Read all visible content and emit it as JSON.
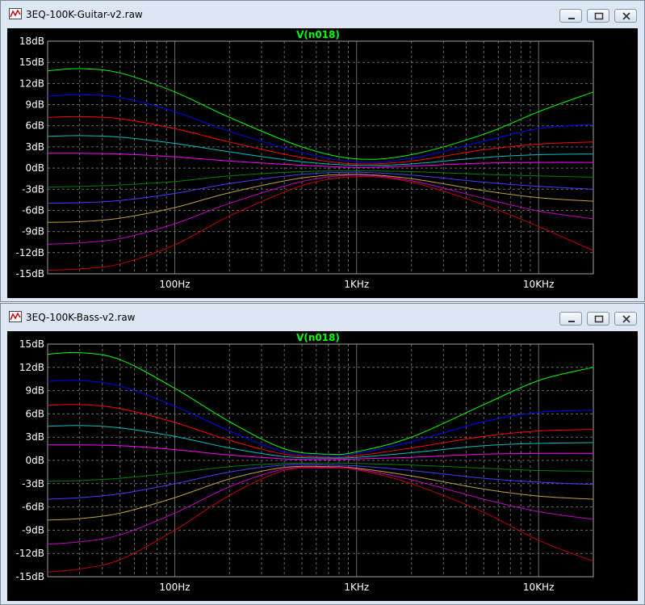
{
  "windows": [
    {
      "title": "3EQ-100K-Guitar-v2.raw",
      "chart_data": {
        "type": "line",
        "title": "V(n018)",
        "x_scale": "log",
        "xlim": [
          20,
          20000
        ],
        "ylim": [
          -15,
          18
        ],
        "y_ticks": [
          "18dB",
          "15dB",
          "12dB",
          "9dB",
          "6dB",
          "3dB",
          "0dB",
          "-3dB",
          "-6dB",
          "-9dB",
          "-12dB",
          "-15dB"
        ],
        "y_tick_values": [
          18,
          15,
          12,
          9,
          6,
          3,
          0,
          -3,
          -6,
          -9,
          -12,
          -15
        ],
        "x_ticks": [
          "100Hz",
          "1KHz",
          "10KHz"
        ],
        "x_tick_values": [
          100,
          1000,
          10000
        ],
        "x": [
          20,
          30,
          50,
          100,
          200,
          500,
          1000,
          2000,
          5000,
          10000,
          20000
        ],
        "series": [
          {
            "color": "#00ff00",
            "values": [
              13.8,
              14.1,
              13.5,
              10.8,
              7.2,
              3.0,
              1.3,
              1.9,
              4.8,
              8.0,
              10.8
            ]
          },
          {
            "color": "#0000ff",
            "values": [
              10.2,
              10.4,
              10.0,
              8.0,
              5.2,
              2.2,
              0.9,
              1.4,
              3.8,
              5.6,
              6.2
            ]
          },
          {
            "color": "#ff0000",
            "values": [
              7.2,
              7.3,
              7.0,
              5.6,
              3.7,
              1.5,
              0.6,
              1.0,
              2.6,
              3.4,
              3.7
            ]
          },
          {
            "color": "#00c0c0",
            "values": [
              4.5,
              4.6,
              4.4,
              3.5,
              2.3,
              0.9,
              0.4,
              0.6,
              1.5,
              1.9,
              2.0
            ]
          },
          {
            "color": "#ff00ff",
            "values": [
              2.1,
              2.1,
              2.0,
              1.6,
              1.0,
              0.4,
              0.1,
              0.3,
              0.7,
              0.8,
              0.8
            ]
          },
          {
            "color": "#008000",
            "values": [
              -2.7,
              -2.6,
              -2.4,
              -1.9,
              -1.1,
              -0.5,
              -0.4,
              -0.5,
              -0.9,
              -1.1,
              -1.3
            ]
          },
          {
            "color": "#4040ff",
            "values": [
              -5.0,
              -4.9,
              -4.6,
              -3.6,
              -2.2,
              -0.9,
              -0.6,
              -1.0,
              -2.0,
              -2.6,
              -3.0
            ]
          },
          {
            "color": "#c0a040",
            "values": [
              -7.7,
              -7.6,
              -7.1,
              -5.6,
              -3.5,
              -1.4,
              -0.9,
              -1.5,
              -3.2,
              -4.2,
              -4.7
            ]
          },
          {
            "color": "#c000c0",
            "values": [
              -10.8,
              -10.6,
              -10.0,
              -7.9,
              -5.0,
              -1.9,
              -1.0,
              -1.8,
              -4.3,
              -6.1,
              -7.2
            ]
          },
          {
            "color": "#c00000",
            "values": [
              -14.5,
              -14.3,
              -13.6,
              -10.9,
              -6.8,
              -2.5,
              -1.2,
              -2.0,
              -5.2,
              -8.3,
              -11.7
            ]
          }
        ],
        "grid": true
      }
    },
    {
      "title": "3EQ-100K-Bass-v2.raw",
      "chart_data": {
        "type": "line",
        "title": "V(n018)",
        "x_scale": "log",
        "xlim": [
          20,
          20000
        ],
        "ylim": [
          -15,
          15
        ],
        "y_ticks": [
          "15dB",
          "12dB",
          "9dB",
          "6dB",
          "3dB",
          "0dB",
          "-3dB",
          "-6dB",
          "-9dB",
          "-12dB",
          "-15dB"
        ],
        "y_tick_values": [
          15,
          12,
          9,
          6,
          3,
          0,
          -3,
          -6,
          -9,
          -12,
          -15
        ],
        "x_ticks": [
          "100Hz",
          "1KHz",
          "10KHz"
        ],
        "x_tick_values": [
          100,
          1000,
          10000
        ],
        "x": [
          20,
          30,
          50,
          100,
          200,
          400,
          700,
          1000,
          2000,
          5000,
          10000,
          20000
        ],
        "series": [
          {
            "color": "#00ff00",
            "values": [
              13.7,
              13.9,
              13.0,
              9.3,
              5.0,
              1.5,
              0.8,
              1.1,
              3.0,
              7.2,
              10.3,
              12.0
            ]
          },
          {
            "color": "#0000ff",
            "values": [
              10.2,
              10.3,
              9.6,
              7.0,
              3.8,
              1.1,
              0.6,
              0.9,
              2.4,
              5.0,
              6.2,
              6.5
            ]
          },
          {
            "color": "#ff0000",
            "values": [
              7.1,
              7.2,
              6.7,
              4.9,
              2.6,
              0.8,
              0.4,
              0.6,
              1.6,
              3.1,
              3.8,
              4.0
            ]
          },
          {
            "color": "#00c0c0",
            "values": [
              4.4,
              4.5,
              4.2,
              3.1,
              1.6,
              0.5,
              0.3,
              0.4,
              1.0,
              1.9,
              2.2,
              2.3
            ]
          },
          {
            "color": "#ff00ff",
            "values": [
              2.0,
              2.0,
              1.9,
              1.4,
              0.7,
              0.2,
              0.1,
              0.2,
              0.4,
              0.8,
              0.9,
              0.9
            ]
          },
          {
            "color": "#008000",
            "values": [
              -2.7,
              -2.6,
              -2.3,
              -1.6,
              -0.8,
              -0.4,
              -0.4,
              -0.4,
              -0.6,
              -1.0,
              -1.3,
              -1.4
            ]
          },
          {
            "color": "#4040ff",
            "values": [
              -5.0,
              -4.8,
              -4.3,
              -3.0,
              -1.5,
              -0.6,
              -0.6,
              -0.7,
              -1.3,
              -2.3,
              -2.8,
              -3.1
            ]
          },
          {
            "color": "#c0a040",
            "values": [
              -7.7,
              -7.5,
              -6.8,
              -4.8,
              -2.4,
              -0.9,
              -0.8,
              -1.0,
              -2.0,
              -3.7,
              -4.6,
              -5.0
            ]
          },
          {
            "color": "#c000c0",
            "values": [
              -10.8,
              -10.5,
              -9.6,
              -6.8,
              -3.4,
              -1.1,
              -0.9,
              -1.1,
              -2.5,
              -5.0,
              -6.6,
              -7.6
            ]
          },
          {
            "color": "#c00000",
            "values": [
              -14.4,
              -14.0,
              -12.8,
              -9.0,
              -4.5,
              -1.3,
              -1.0,
              -1.2,
              -3.0,
              -6.7,
              -10.3,
              -13.0
            ]
          }
        ],
        "grid": true
      }
    }
  ]
}
